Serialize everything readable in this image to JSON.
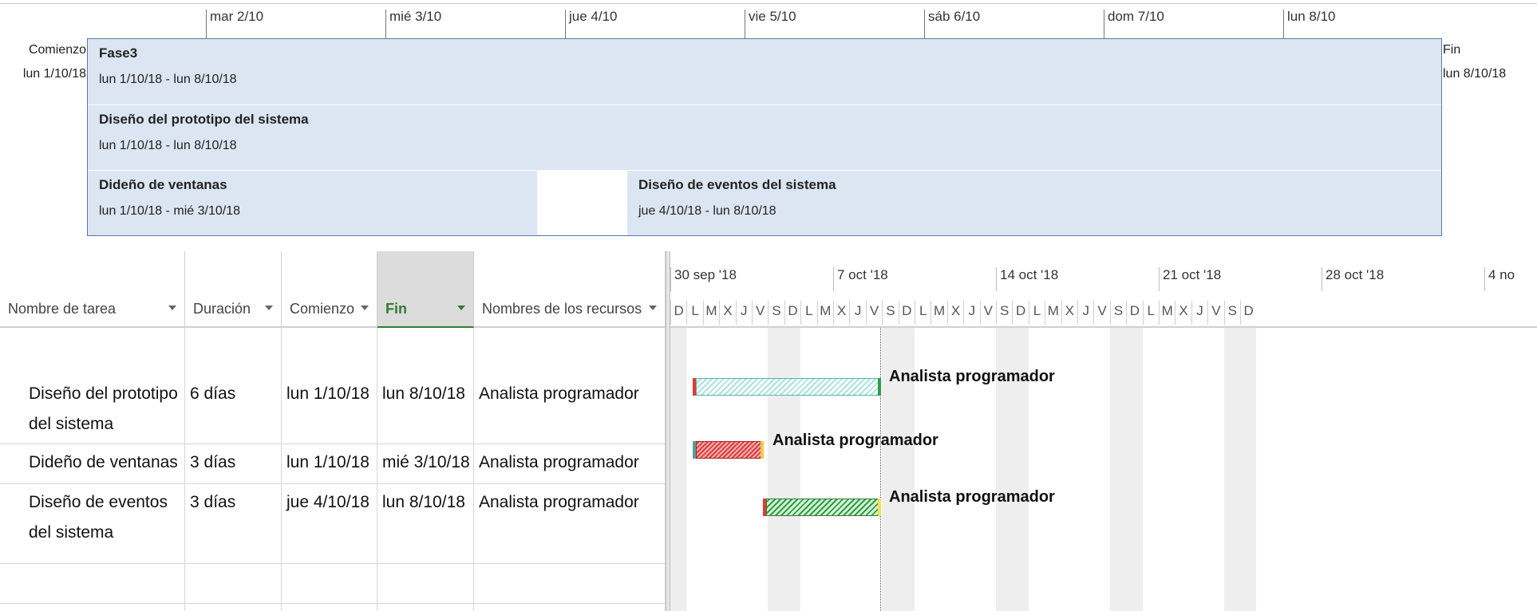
{
  "timeline": {
    "ticks": [
      "mar 2/10",
      "mié 3/10",
      "jue 4/10",
      "vie 5/10",
      "sáb 6/10",
      "dom 7/10",
      "lun 8/10"
    ],
    "start_label": "Comienzo",
    "start_date": "lun 1/10/18",
    "end_label": "Fin",
    "end_date": "lun 8/10/18",
    "blocks": [
      {
        "name": "Fase3",
        "dates": "lun 1/10/18 - lun 8/10/18"
      },
      {
        "name": "Diseño del prototipo del sistema",
        "dates": "lun 1/10/18 - lun 8/10/18"
      },
      {
        "name": "Dideño de ventanas",
        "dates": "lun 1/10/18 - mié 3/10/18"
      },
      {
        "name": "Diseño de eventos del sistema",
        "dates": "jue 4/10/18 - lun 8/10/18"
      }
    ]
  },
  "table": {
    "columns": [
      {
        "label": "Nombre de tarea"
      },
      {
        "label": "Duración"
      },
      {
        "label": "Comienzo"
      },
      {
        "label": "Fin"
      },
      {
        "label": "Nombres de los recursos"
      }
    ],
    "rows": [
      {
        "name_line1": "Diseño del prototipo",
        "name_line2": "del sistema",
        "duration": "6 días",
        "start": "lun 1/10/18",
        "end": "lun 8/10/18",
        "resources": "Analista programador"
      },
      {
        "name_line1": "Dideño de ventanas",
        "name_line2": "",
        "duration": "3 días",
        "start": "lun 1/10/18",
        "end": "mié 3/10/18",
        "resources": "Analista programador"
      },
      {
        "name_line1": "Diseño de eventos",
        "name_line2": "del sistema",
        "duration": "3 días",
        "start": "jue 4/10/18",
        "end": "lun 8/10/18",
        "resources": "Analista programador"
      }
    ]
  },
  "gantt": {
    "weeks": [
      "30 sep '18",
      "7 oct '18",
      "14 oct '18",
      "21 oct '18",
      "28 oct '18",
      "4 no"
    ],
    "day_letters": [
      "D",
      "L",
      "M",
      "X",
      "J",
      "V",
      "S",
      "D",
      "L",
      "M",
      "X",
      "J",
      "V",
      "S",
      "D",
      "L",
      "M",
      "X",
      "J",
      "V",
      "S",
      "D",
      "L",
      "M",
      "X",
      "J",
      "V",
      "S",
      "D",
      "L",
      "M",
      "X",
      "J",
      "V",
      "S",
      "D"
    ],
    "bar_labels": [
      "Analista programador",
      "Analista programador",
      "Analista programador"
    ]
  },
  "colors": {
    "timeline_fill": "#dce6f2",
    "timeline_border": "#5b7aa3",
    "active_header": "#2e7d32",
    "bar_teal": "#57b3ad",
    "bar_red": "#e03a3a",
    "bar_green": "#2e9d45"
  }
}
